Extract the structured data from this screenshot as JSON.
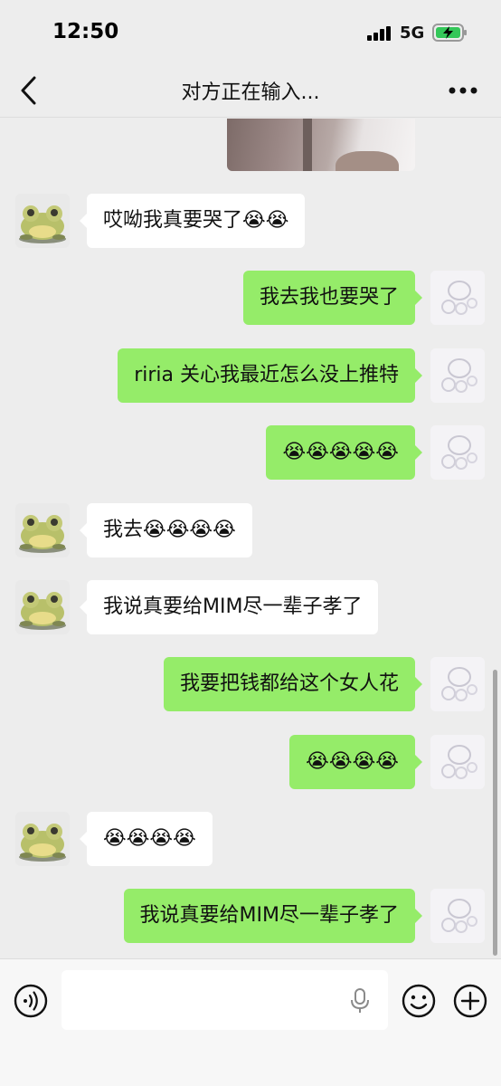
{
  "status_bar": {
    "time": "12:50",
    "network": "5G"
  },
  "header": {
    "title": "对方正在输入..."
  },
  "messages": [
    {
      "side": "in",
      "text": "哎呦我真要哭了😭😭"
    },
    {
      "side": "out",
      "text": "我去我也要哭了"
    },
    {
      "side": "out",
      "text": "riria 关心我最近怎么没上推特"
    },
    {
      "side": "out",
      "text": "😭😭😭😭😭"
    },
    {
      "side": "in",
      "text": "我去😭😭😭😭"
    },
    {
      "side": "in",
      "text": "我说真要给MIM尽一辈子孝了"
    },
    {
      "side": "out",
      "text": "我要把钱都给这个女人花"
    },
    {
      "side": "out",
      "text": "😭😭😭😭"
    },
    {
      "side": "in",
      "text": "😭😭😭😭"
    },
    {
      "side": "out",
      "text": "我说真要给MIM尽一辈子孝了"
    }
  ],
  "input": {
    "value": "",
    "placeholder": ""
  },
  "colors": {
    "background": "#ededed",
    "outgoing_bubble": "#95ec69",
    "incoming_bubble": "#ffffff"
  },
  "icons": {
    "back": "chevron-left-icon",
    "more": "more-dots-icon",
    "voice": "voice-icon",
    "mic": "mic-icon",
    "emoji": "emoji-icon",
    "plus": "plus-icon"
  }
}
